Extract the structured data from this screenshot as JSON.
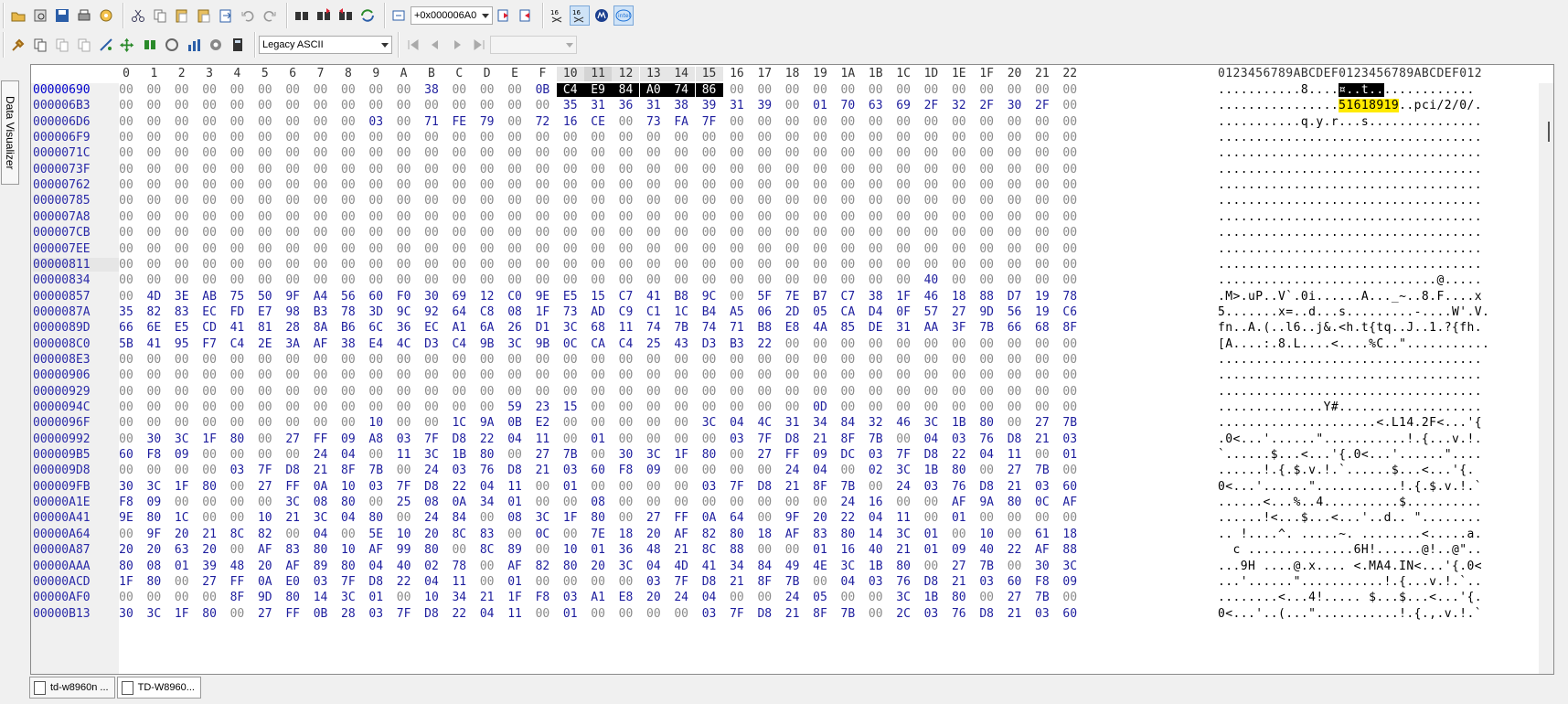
{
  "toolbar1": {
    "buttons": [
      "open-icon",
      "print-preview-icon",
      "save-icon",
      "print-icon",
      "properties-icon",
      "cut-icon",
      "copy-icon",
      "paste-icon",
      "paste-special-icon",
      "paste-into-icon",
      "undo-icon",
      "redo-icon",
      "find-icon",
      "find-next-icon",
      "find-prev-icon",
      "replace-icon",
      "goto-icon",
      "goto-next-icon",
      "goto-prev-icon",
      "hex16-icon",
      "hex16-alt-icon",
      "motorola-icon",
      "intel-icon"
    ],
    "offset_combo": "+0x000006A0"
  },
  "toolbar2": {
    "buttons": [
      "tools-icon",
      "copy-block-icon",
      "copy-alt-icon",
      "copy-more-icon",
      "analyze-icon",
      "modify-icon",
      "compare-icon",
      "hash-icon",
      "stats-icon",
      "options-icon",
      "calculator-icon"
    ],
    "charset_combo": "Legacy ASCII",
    "nav_buttons": [
      "first-icon",
      "prev-icon",
      "next-icon",
      "last-icon"
    ],
    "nav_combo": ""
  },
  "sidetab_label": "Data Visualizer",
  "hex_header": [
    "0",
    "1",
    "2",
    "3",
    "4",
    "5",
    "6",
    "7",
    "8",
    "9",
    "A",
    "B",
    "C",
    "D",
    "E",
    "F",
    "10",
    "11",
    "12",
    "13",
    "14",
    "15",
    "16",
    "17",
    "18",
    "19",
    "1A",
    "1B",
    "1C",
    "1D",
    "1E",
    "1F",
    "20",
    "21",
    "22"
  ],
  "ascii_header": "0123456789ABCDEF0123456789ABCDEF012",
  "rows": [
    {
      "offset": "00000690",
      "hex": "00 00 00 00 00 00 00 00 00 00 00 38 00 00 00 0B C4 E9 84 A0 74 86 00 00 00 00 00 00 00 00 00 00 00 00 00",
      "ascii": "...........8....¤..t.............."
    },
    {
      "offset": "000006B3",
      "hex": "00 00 00 00 00 00 00 00 00 00 00 00 00 00 00 00 35 31 36 31 38 39 31 39 00 01 70 63 69 2F 32 2F 30 2F 00",
      "ascii": "................51618919..pci/2/0/."
    },
    {
      "offset": "000006D6",
      "hex": "00 00 00 00 00 00 00 00 00 03 00 71 FE 79 00 72 16 CE 00 73 FA 7F 00 00 00 00 00 00 00 00 00 00 00 00 00",
      "ascii": "...........q.y.r...s..............."
    },
    {
      "offset": "000006F9",
      "hex": "00 00 00 00 00 00 00 00 00 00 00 00 00 00 00 00 00 00 00 00 00 00 00 00 00 00 00 00 00 00 00 00 00 00 00",
      "ascii": "..................................."
    },
    {
      "offset": "0000071C",
      "hex": "00 00 00 00 00 00 00 00 00 00 00 00 00 00 00 00 00 00 00 00 00 00 00 00 00 00 00 00 00 00 00 00 00 00 00",
      "ascii": "..................................."
    },
    {
      "offset": "0000073F",
      "hex": "00 00 00 00 00 00 00 00 00 00 00 00 00 00 00 00 00 00 00 00 00 00 00 00 00 00 00 00 00 00 00 00 00 00 00",
      "ascii": "..................................."
    },
    {
      "offset": "00000762",
      "hex": "00 00 00 00 00 00 00 00 00 00 00 00 00 00 00 00 00 00 00 00 00 00 00 00 00 00 00 00 00 00 00 00 00 00 00",
      "ascii": "..................................."
    },
    {
      "offset": "00000785",
      "hex": "00 00 00 00 00 00 00 00 00 00 00 00 00 00 00 00 00 00 00 00 00 00 00 00 00 00 00 00 00 00 00 00 00 00 00",
      "ascii": "..................................."
    },
    {
      "offset": "000007A8",
      "hex": "00 00 00 00 00 00 00 00 00 00 00 00 00 00 00 00 00 00 00 00 00 00 00 00 00 00 00 00 00 00 00 00 00 00 00",
      "ascii": "..................................."
    },
    {
      "offset": "000007CB",
      "hex": "00 00 00 00 00 00 00 00 00 00 00 00 00 00 00 00 00 00 00 00 00 00 00 00 00 00 00 00 00 00 00 00 00 00 00",
      "ascii": "..................................."
    },
    {
      "offset": "000007EE",
      "hex": "00 00 00 00 00 00 00 00 00 00 00 00 00 00 00 00 00 00 00 00 00 00 00 00 00 00 00 00 00 00 00 00 00 00 00",
      "ascii": "..................................."
    },
    {
      "offset": "00000811",
      "hex": "00 00 00 00 00 00 00 00 00 00 00 00 00 00 00 00 00 00 00 00 00 00 00 00 00 00 00 00 00 00 00 00 00 00 00",
      "ascii": "..................................."
    },
    {
      "offset": "00000834",
      "hex": "00 00 00 00 00 00 00 00 00 00 00 00 00 00 00 00 00 00 00 00 00 00 00 00 00 00 00 00 00 40 00 00 00 00 00",
      "ascii": ".............................@....."
    },
    {
      "offset": "00000857",
      "hex": "00 4D 3E AB 75 50 9F A4 56 60 F0 30 69 12 C0 9E E5 15 C7 41 B8 9C 00 5F 7E B7 C7 38 1F 46 18 88 D7 19 78",
      "ascii": ".M>.uP..V`.0i......A..._~..8.F....x"
    },
    {
      "offset": "0000087A",
      "hex": "35 82 83 EC FD E7 98 B3 78 3D 9C 92 64 C8 08 1F 73 AD C9 C1 1C B4 A5 06 2D 05 CA D4 0F 57 27 9D 56 19 C6",
      "ascii": "5.......x=..d...s.........-....W'.V."
    },
    {
      "offset": "0000089D",
      "hex": "66 6E E5 CD 41 81 28 8A B6 6C 36 EC A1 6A 26 D1 3C 68 11 74 7B 74 71 B8 E8 4A 85 DE 31 AA 3F 7B 66 68 8F",
      "ascii": "fn..A.(..l6..j&.<h.t{tq..J..1.?{fh."
    },
    {
      "offset": "000008C0",
      "hex": "5B 41 95 F7 C4 2E 3A AF 38 E4 4C D3 C4 9B 3C 9B 0C CA C4 25 43 D3 B3 22 00 00 00 00 00 00 00 00 00 00 00",
      "ascii": "[A....:.8.L....<....%C..\"..........."
    },
    {
      "offset": "000008E3",
      "hex": "00 00 00 00 00 00 00 00 00 00 00 00 00 00 00 00 00 00 00 00 00 00 00 00 00 00 00 00 00 00 00 00 00 00 00",
      "ascii": "..................................."
    },
    {
      "offset": "00000906",
      "hex": "00 00 00 00 00 00 00 00 00 00 00 00 00 00 00 00 00 00 00 00 00 00 00 00 00 00 00 00 00 00 00 00 00 00 00",
      "ascii": "..................................."
    },
    {
      "offset": "00000929",
      "hex": "00 00 00 00 00 00 00 00 00 00 00 00 00 00 00 00 00 00 00 00 00 00 00 00 00 00 00 00 00 00 00 00 00 00 00",
      "ascii": "..................................."
    },
    {
      "offset": "0000094C",
      "hex": "00 00 00 00 00 00 00 00 00 00 00 00 00 00 59 23 15 00 00 00 00 00 00 00 00 0D 00 00 00 00 00 00 00 00 00",
      "ascii": "..............Y#..................."
    },
    {
      "offset": "0000096F",
      "hex": "00 00 00 00 00 00 00 00 00 10 00 00 1C 9A 0B E2 00 00 00 00 00 3C 04 4C 31 34 84 32 46 3C 1B 80 00 27 7B",
      "ascii": ".....................<.L14.2F<...'{"
    },
    {
      "offset": "00000992",
      "hex": "00 30 3C 1F 80 00 27 FF 09 A8 03 7F D8 22 04 11 00 01 00 00 00 00 03 7F D8 21 8F 7B 00 04 03 76 D8 21 03",
      "ascii": ".0<...'......\"...........!.{...v.!."
    },
    {
      "offset": "000009B5",
      "hex": "60 F8 09 00 00 00 00 24 04 00 11 3C 1B 80 00 27 7B 00 30 3C 1F 80 00 27 FF 09 DC 03 7F D8 22 04 11 00 01",
      "ascii": "`......$...<...'{.0<...'......\"...."
    },
    {
      "offset": "000009D8",
      "hex": "00 00 00 00 03 7F D8 21 8F 7B 00 24 03 76 D8 21 03 60 F8 09 00 00 00 00 24 04 00 02 3C 1B 80 00 27 7B 00",
      "ascii": "......!.{.$.v.!.`......$...<...'{."
    },
    {
      "offset": "000009FB",
      "hex": "30 3C 1F 80 00 27 FF 0A 10 03 7F D8 22 04 11 00 01 00 00 00 00 03 7F D8 21 8F 7B 00 24 03 76 D8 21 03 60",
      "ascii": "0<...'......\"...........!.{.$.v.!.`"
    },
    {
      "offset": "00000A1E",
      "hex": "F8 09 00 00 00 00 3C 08 80 00 25 08 0A 34 01 00 00 08 00 00 00 00 00 00 00 00 24 16 00 00 AF 9A 80 0C AF",
      "ascii": "......<...%..4..........$.........."
    },
    {
      "offset": "00000A41",
      "hex": "9E 80 1C 00 00 10 21 3C 04 80 00 24 84 00 08 3C 1F 80 00 27 FF 0A 64 00 9F 20 22 04 11 00 01 00 00 00 00",
      "ascii": "......!<...$...<...'..d.. \"........"
    },
    {
      "offset": "00000A64",
      "hex": "00 9F 20 21 8C 82 00 04 00 5E 10 20 8C 83 00 0C 00 7E 18 20 AF 82 80 18 AF 83 80 14 3C 01 00 10 00 61 18",
      "ascii": ".. !....^. .....~. ........<.....a."
    },
    {
      "offset": "00000A87",
      "hex": "20 20 63 20 00 AF 83 80 10 AF 99 80 00 8C 89 00 10 01 36 48 21 8C 88 00 00 01 16 40 21 01 09 40 22 AF 88",
      "ascii": "  c ..............6H!......@!..@\".."
    },
    {
      "offset": "00000AAA",
      "hex": "80 08 01 39 48 20 AF 89 80 04 40 02 78 00 AF 82 80 20 3C 04 4D 41 34 84 49 4E 3C 1B 80 00 27 7B 00 30 3C",
      "ascii": "...9H ....@.x.... <.MA4.IN<...'{.0<"
    },
    {
      "offset": "00000ACD",
      "hex": "1F 80 00 27 FF 0A E0 03 7F D8 22 04 11 00 01 00 00 00 00 03 7F D8 21 8F 7B 00 04 03 76 D8 21 03 60 F8 09",
      "ascii": "...'......\"...........!.{...v.!.`.."
    },
    {
      "offset": "00000AF0",
      "hex": "00 00 00 00 8F 9D 80 14 3C 01 00 10 34 21 1F F8 03 A1 E8 20 24 04 00 00 24 05 00 00 3C 1B 80 00 27 7B 00",
      "ascii": "........<...4!..... $...$...<...'{."
    },
    {
      "offset": "00000B13",
      "hex": "30 3C 1F 80 00 27 FF 0B 28 03 7F D8 22 04 11 00 01 00 00 00 00 03 7F D8 21 8F 7B 00 2C 03 76 D8 21 03 60",
      "ascii": "0<...'..(...\"...........!.{.,.v.!.`"
    }
  ],
  "tabs": [
    {
      "label": "td-w8960n ..."
    },
    {
      "label": "TD-W8960..."
    }
  ],
  "colors": {
    "accent_select": "#000000",
    "highlight": "#ffea00",
    "hex_text": "#1e1e9e",
    "zero_text": "#8a8a8a"
  }
}
